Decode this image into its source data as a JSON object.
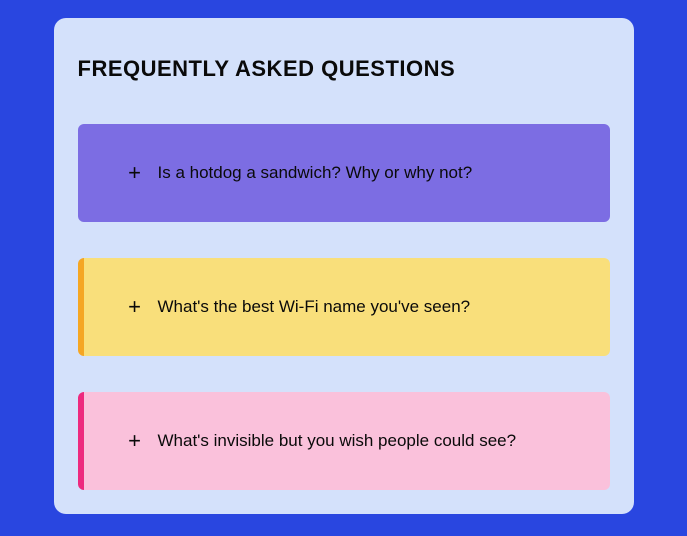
{
  "title": "FREQUENTLY ASKED QUESTIONS",
  "items": [
    {
      "question": "Is a hotdog a sandwich? Why or why not?",
      "icon": "+",
      "variant": "purple"
    },
    {
      "question": "What's the best Wi-Fi name you've seen?",
      "icon": "+",
      "variant": "yellow"
    },
    {
      "question": "What's invisible but you wish people could see?",
      "icon": "+",
      "variant": "pink"
    }
  ],
  "colors": {
    "background": "#2946e0",
    "container": "#d4e1fb",
    "purple": "#7c6de3",
    "yellow": "#f9df7b",
    "yellowAccent": "#f5a623",
    "pink": "#fac1db",
    "pinkAccent": "#ed297e"
  }
}
